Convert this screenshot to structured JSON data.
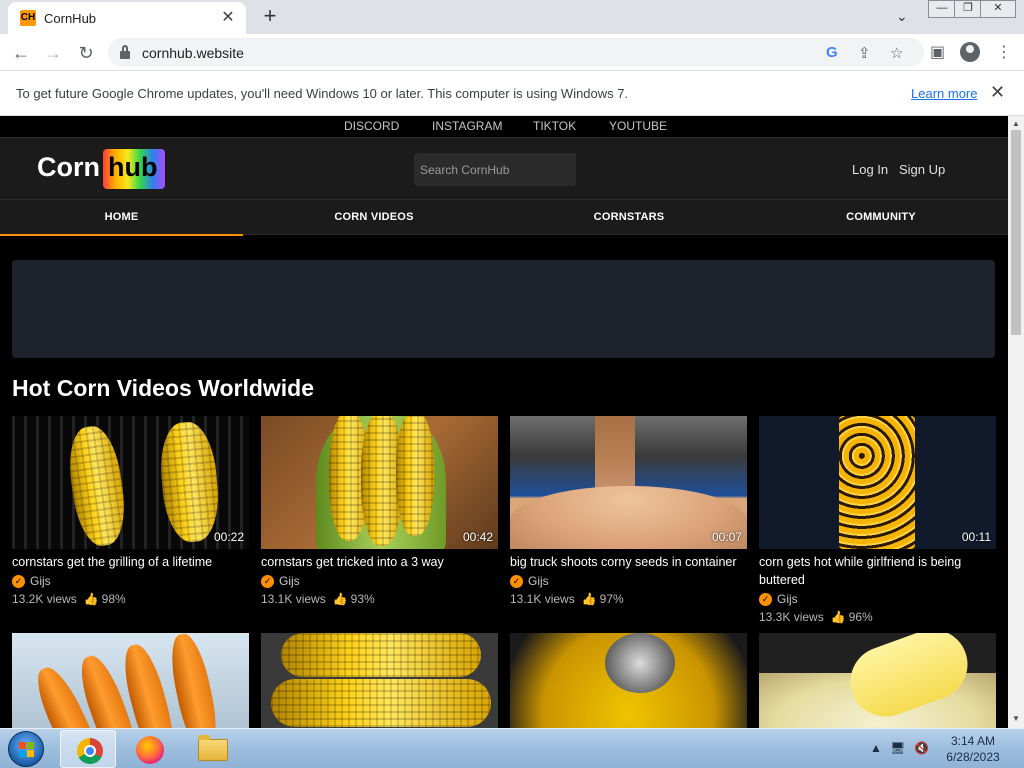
{
  "browser": {
    "tab_title": "CornHub",
    "tab_favicon": "CH",
    "url": "cornhub.website",
    "infobar_message": "To get future Google Chrome updates, you'll need Windows 10 or later. This computer is using Windows 7.",
    "infobar_link": "Learn more"
  },
  "site": {
    "social_links": [
      "DISCORD",
      "INSTAGRAM",
      "TIKTOK",
      "YOUTUBE"
    ],
    "logo_left": "Corn",
    "logo_right": "hub",
    "search_placeholder": "Search CornHub",
    "login_label": "Log In",
    "signup_label": "Sign Up",
    "nav": [
      "HOME",
      "CORN VIDEOS",
      "CORNSTARS",
      "COMMUNITY"
    ],
    "active_nav": "HOME",
    "accent_color": "#ff9000",
    "section_title": "Hot Corn Videos Worldwide"
  },
  "videos": [
    {
      "duration": "00:22",
      "title": "cornstars get the grilling of a lifetime",
      "uploader": "Gijs",
      "views": "13.2K views",
      "rating": "98%"
    },
    {
      "duration": "00:42",
      "title": "cornstars get tricked into a 3 way",
      "uploader": "Gijs",
      "views": "13.1K views",
      "rating": "93%"
    },
    {
      "duration": "00:07",
      "title": "big truck shoots corny seeds in container",
      "uploader": "Gijs",
      "views": "13.1K views",
      "rating": "97%"
    },
    {
      "duration": "00:11",
      "title": "corn gets hot while girlfriend is being buttered",
      "uploader": "Gijs",
      "views": "13.3K views",
      "rating": "96%"
    }
  ],
  "taskbar": {
    "time": "3:14 AM",
    "date": "6/28/2023"
  },
  "icons": {
    "verified": "check-badge-icon",
    "rating": "thumbs-up-icon"
  }
}
